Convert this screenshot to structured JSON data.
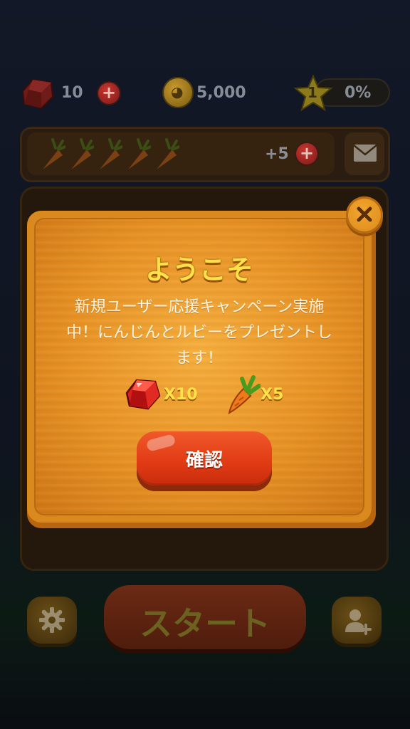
{
  "status_bar": {
    "ruby_count": "10",
    "coin_count": "5,000",
    "star_level": "1",
    "progress_percent": "0%"
  },
  "carrot_bar": {
    "carrot_slots": 5,
    "bonus_text": "+5"
  },
  "bottom_nav": {
    "start_label": "スタート"
  },
  "welcome_dialog": {
    "title": "ようこそ",
    "message": "新規ユーザー応援キャンペーン実施中！にんじんとルビーをプレゼントします！",
    "rewards": [
      {
        "icon": "ruby-icon",
        "quantity": "X10"
      },
      {
        "icon": "carrot-icon",
        "quantity": "X5"
      }
    ],
    "confirm_label": "確認"
  },
  "colors": {
    "title_yellow": "#ffe24a",
    "confirm_red": "#e03a14",
    "wood_orange": "#e89224"
  }
}
